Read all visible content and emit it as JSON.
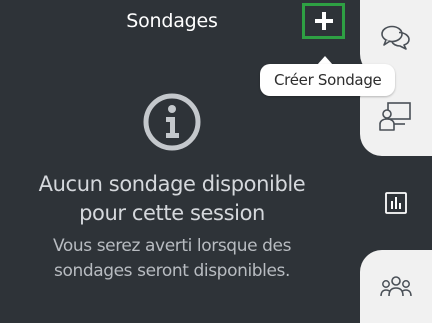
{
  "panel": {
    "title": "Sondages",
    "add_button_icon": "plus-icon"
  },
  "tooltip": {
    "text": "Créer Sondage"
  },
  "empty_state": {
    "icon": "info-icon",
    "title_line1": "Aucun sondage disponible",
    "title_line2": "pour cette session",
    "subtitle_line1": "Vous serez averti lorsque des",
    "subtitle_line2": "sondages seront disponibles."
  },
  "rail": {
    "tabs": [
      {
        "icon": "chat-icon",
        "active": false
      },
      {
        "icon": "presentation-icon",
        "active": false
      },
      {
        "icon": "poll-chart-icon",
        "active": true
      },
      {
        "icon": "participants-icon",
        "active": false
      }
    ]
  },
  "colors": {
    "panel_bg": "#2e3338",
    "rail_tab_bg": "#f1f1f1",
    "highlight_border": "#2ea043",
    "text_primary": "#ffffff",
    "text_secondary": "#b8bcc1"
  }
}
